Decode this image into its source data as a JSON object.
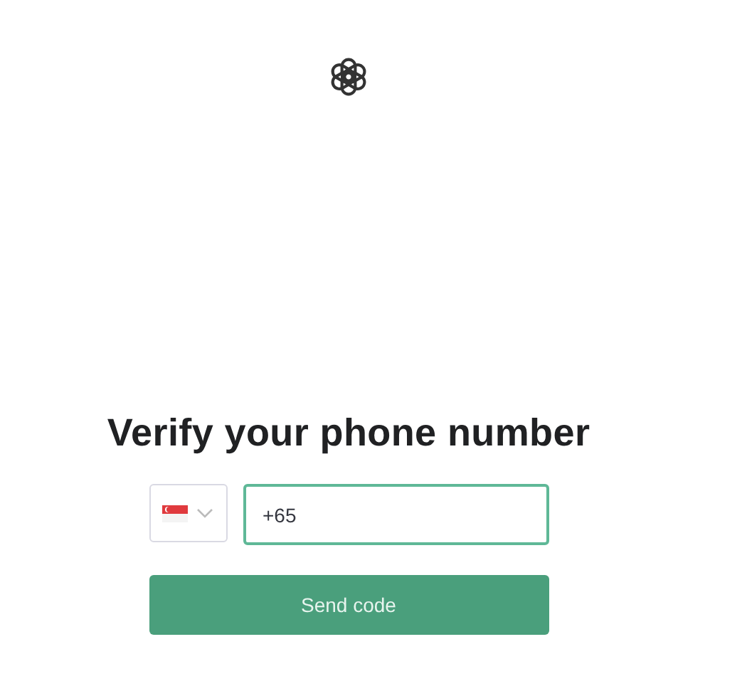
{
  "title": "Verify your phone number",
  "phone": {
    "value": "+65",
    "focused": true
  },
  "submit": {
    "label": "Send code"
  }
}
